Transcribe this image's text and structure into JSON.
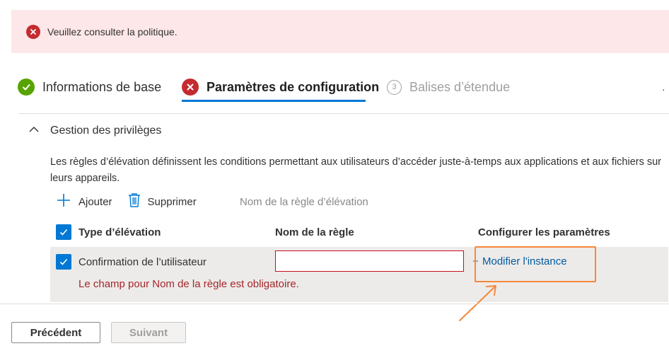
{
  "banner": {
    "message": "Veuillez consulter la politique.",
    "icon": "error-circle-icon"
  },
  "steps": [
    {
      "label": "Informations de base",
      "status": "complete",
      "icon": "checkmark-circle-icon"
    },
    {
      "label": "Paramètres de configuration",
      "status": "error",
      "icon": "error-circle-icon"
    },
    {
      "label": "Balises d’étendue",
      "status": "pending",
      "number": "3"
    }
  ],
  "section": {
    "title": "Gestion des privilèges",
    "description": "Les règles d’élévation définissent les conditions permettant aux utilisateurs d’accéder juste-à-temps aux applications et aux fichiers sur leurs appareils."
  },
  "toolbar": {
    "add_label": "Ajouter",
    "delete_label": "Supprimer",
    "search_placeholder": "Nom de la règle d’élévation"
  },
  "table": {
    "columns": [
      "Type d’élévation",
      "Nom de la règle",
      "Configurer les paramètres"
    ],
    "rows": [
      {
        "type": "Confirmation de l’utilisateur",
        "rule_name": "",
        "configure_prefix": "+",
        "configure_link": "Modifier l'instance",
        "error": "Le champ pour Nom de la règle est obligatoire."
      }
    ]
  },
  "footer": {
    "previous_label": "Précédent",
    "next_label": "Suivant"
  },
  "colors": {
    "accent": "#0078d4",
    "error": "#c42b2f",
    "success": "#57a300",
    "highlight": "#f5883b"
  }
}
